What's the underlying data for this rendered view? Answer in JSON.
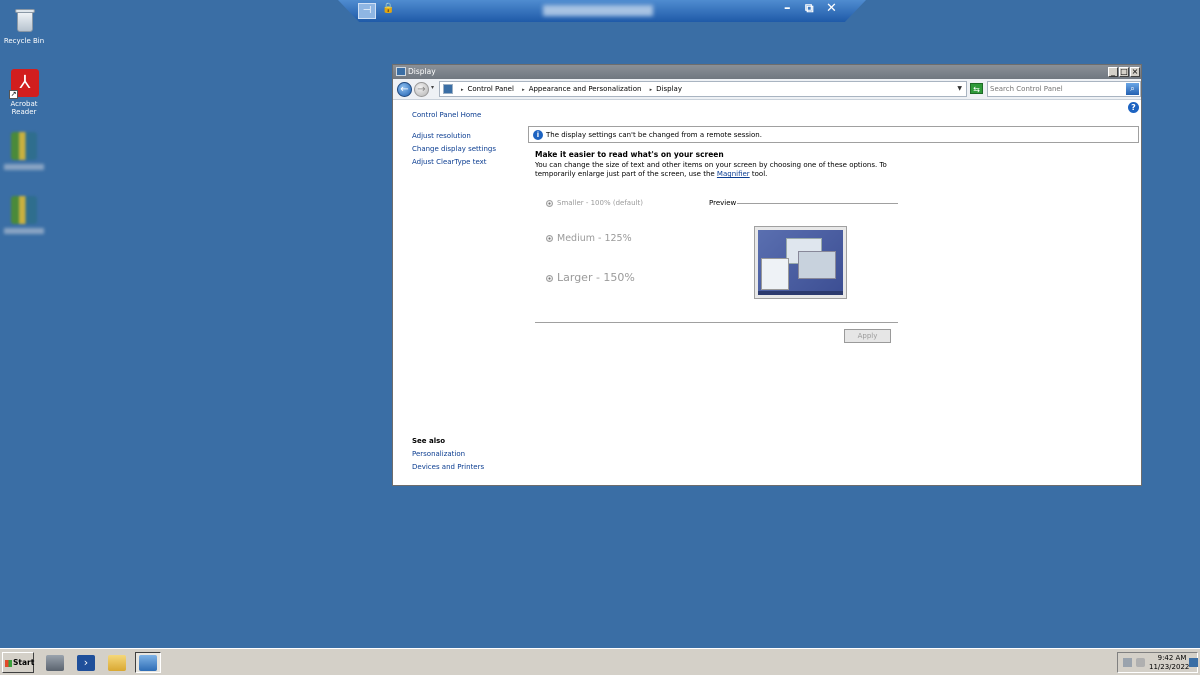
{
  "desktop": {
    "icons": [
      {
        "label": "Recycle Bin",
        "icon": "recycle-bin-icon"
      },
      {
        "label": "Acrobat Reader",
        "icon": "acrobat-reader-icon"
      }
    ]
  },
  "window": {
    "title": "Display",
    "breadcrumb": [
      "Control Panel",
      "Appearance and Personalization",
      "Display"
    ],
    "search_placeholder": "Search Control Panel",
    "sidebar": {
      "home": "Control Panel Home",
      "links": [
        "Adjust resolution",
        "Change display settings",
        "Adjust ClearType text"
      ],
      "see_also_heading": "See also",
      "see_also": [
        "Personalization",
        "Devices and Printers"
      ]
    },
    "info_message": "The display settings can't be changed from a remote session.",
    "heading": "Make it easier to read what's on your screen",
    "description_prefix": "You can change the size of text and other items on your screen by choosing one of these options. To temporarily enlarge just part of the screen, use the ",
    "description_link": "Magnifier",
    "description_suffix": " tool.",
    "options": [
      {
        "label": "Smaller - 100% (default)",
        "selected": true
      },
      {
        "label": "Medium - 125%",
        "selected": false
      },
      {
        "label": "Larger - 150%",
        "selected": false
      }
    ],
    "preview_label": "Preview",
    "apply_label": "Apply"
  },
  "taskbar": {
    "start_label": "Start",
    "time": "9:42 AM",
    "date": "11/23/2022"
  },
  "colors": {
    "desktop": "#3a6ea5",
    "link": "#0b3d91",
    "disabled_text": "#9a9a9a"
  }
}
